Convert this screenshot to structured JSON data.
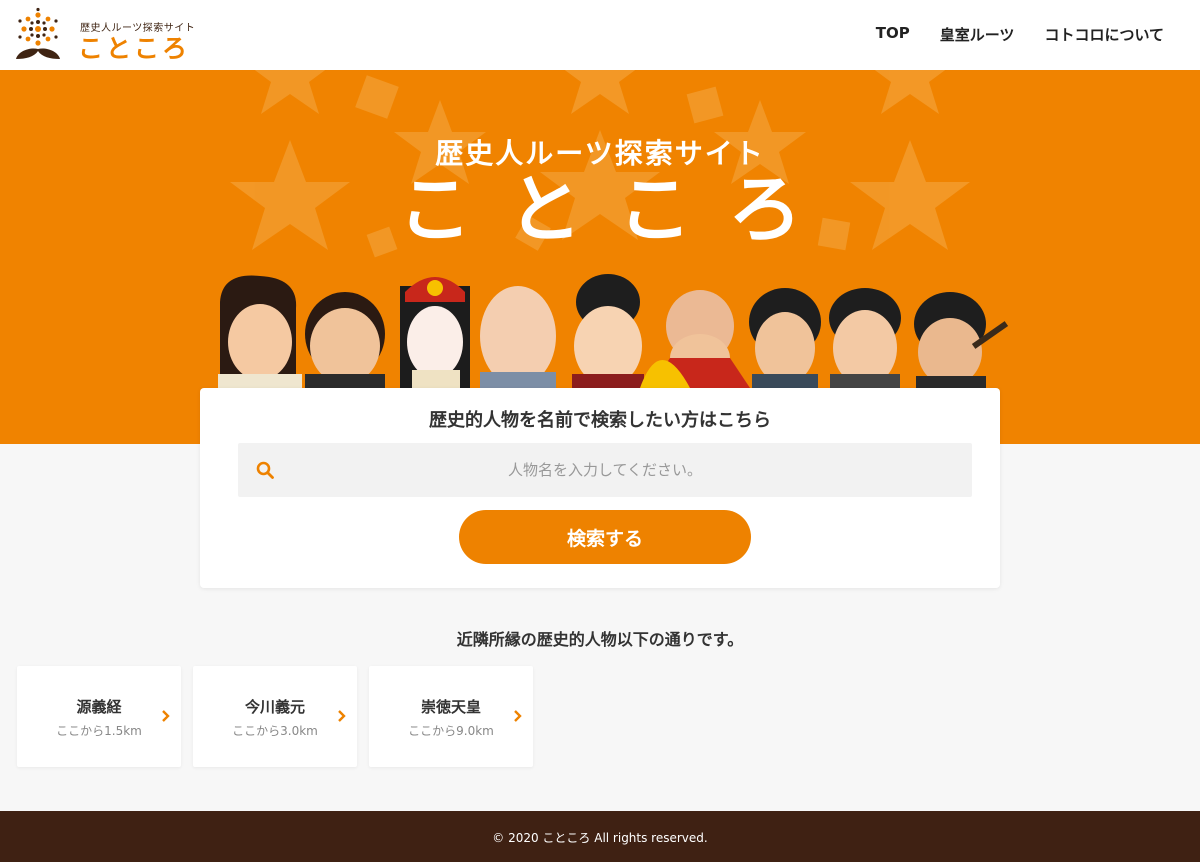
{
  "colors": {
    "accent": "#ee8200",
    "hero_bg": "#f08300",
    "footer_bg": "#3f2113",
    "logo_brown": "#3f2413"
  },
  "header": {
    "logo_sub": "歴史人ルーツ探索サイト",
    "logo_main": "こところ",
    "nav": [
      {
        "label": "TOP"
      },
      {
        "label": "皇室ルーツ"
      },
      {
        "label": "コトコロについて"
      }
    ]
  },
  "hero": {
    "subtitle": "歴史人ルーツ探索サイト",
    "title": "こところ"
  },
  "search": {
    "heading": "歴史的人物を名前で検索したい方はこちら",
    "placeholder": "人物名を入力してください。",
    "value": "",
    "icon": "search-icon",
    "button_label": "検索する"
  },
  "nearby": {
    "heading": "近隣所縁の歴史的人物以下の通りです。",
    "items": [
      {
        "name": "源義経",
        "distance": "ここから1.5km"
      },
      {
        "name": "今川義元",
        "distance": "ここから3.0km"
      },
      {
        "name": "崇徳天皇",
        "distance": "ここから9.0km"
      }
    ]
  },
  "footer": {
    "copyright": "© 2020 こところ All rights reserved."
  }
}
